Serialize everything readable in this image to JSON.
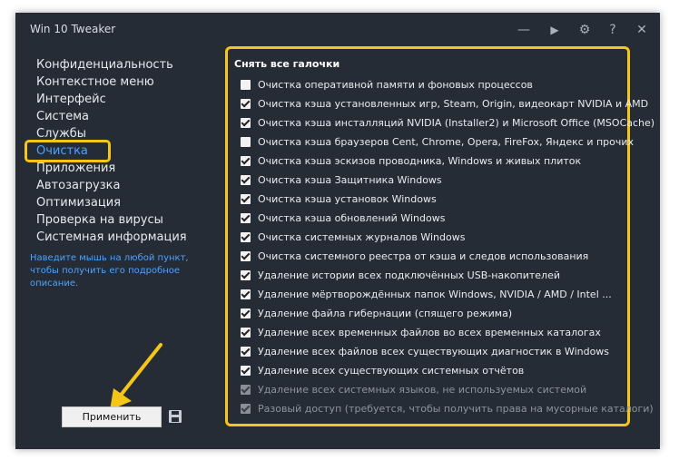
{
  "window": {
    "title": "Win 10 Tweaker"
  },
  "titlebar": {
    "minimize": "—",
    "run": "▶",
    "settings": "⚙",
    "help": "?",
    "close": "✕"
  },
  "nav": {
    "items": [
      {
        "label": "Конфиденциальность"
      },
      {
        "label": "Контекстное меню"
      },
      {
        "label": "Интерфейс"
      },
      {
        "label": "Система"
      },
      {
        "label": "Службы"
      },
      {
        "label": "Очистка"
      },
      {
        "label": "Приложения"
      },
      {
        "label": "Автозагрузка"
      },
      {
        "label": "Оптимизация"
      },
      {
        "label": "Проверка на вирусы"
      },
      {
        "label": "Системная информация"
      }
    ],
    "active": "Очистка",
    "hint": "Наведите мышь на любой пункт, чтобы получить его подробное описание."
  },
  "apply_label": "Применить",
  "panel": {
    "header": "Снять все галочки",
    "items": [
      {
        "label": "Очистка оперативной памяти и фоновых процессов",
        "checked": false,
        "disabled": false
      },
      {
        "label": "Очистка кэша установленных игр, Steam, Origin, видеокарт NVIDIA и AMD",
        "checked": true,
        "disabled": false
      },
      {
        "label": "Очистка кэша инсталляций NVIDIA (Installer2) и Microsoft Office (MSOCache)",
        "checked": true,
        "disabled": false
      },
      {
        "label": "Очистка кэша браузеров Cent, Chrome, Opera, FireFox, Яндекс и прочих",
        "checked": false,
        "disabled": false
      },
      {
        "label": "Очистка кэша эскизов проводника, Windows и живых плиток",
        "checked": true,
        "disabled": false
      },
      {
        "label": "Очистка кэша Защитника Windows",
        "checked": true,
        "disabled": false
      },
      {
        "label": "Очистка кэша установок Windows",
        "checked": true,
        "disabled": false
      },
      {
        "label": "Очистка кэша обновлений Windows",
        "checked": true,
        "disabled": false
      },
      {
        "label": "Очистка системных журналов Windows",
        "checked": true,
        "disabled": false
      },
      {
        "label": "Очистка системного реестра от кэша и следов использования",
        "checked": true,
        "disabled": false
      },
      {
        "label": "Удаление истории всех подключённых USB-накопителей",
        "checked": true,
        "disabled": false
      },
      {
        "label": "Удаление мёртворождённых папок Windows, NVIDIA / AMD / Intel ...",
        "checked": true,
        "disabled": false
      },
      {
        "label": "Удаление файла гибернации (спящего режима)",
        "checked": true,
        "disabled": false
      },
      {
        "label": "Удаление всех временных файлов во всех временных каталогах",
        "checked": true,
        "disabled": false
      },
      {
        "label": "Удаление всех файлов всех существующих диагностик в Windows",
        "checked": true,
        "disabled": false
      },
      {
        "label": "Удаление всех существующих системных отчётов",
        "checked": true,
        "disabled": false
      },
      {
        "label": "Удаление всех системных языков, не используемых системой",
        "checked": true,
        "disabled": true
      },
      {
        "label": "Разовый доступ (требуется, чтобы получить права на мусорные каталоги)",
        "checked": true,
        "disabled": true
      }
    ]
  },
  "colors": {
    "window_bg": "#262c36",
    "accent": "#4aa3ff",
    "highlight": "#f5c518"
  }
}
